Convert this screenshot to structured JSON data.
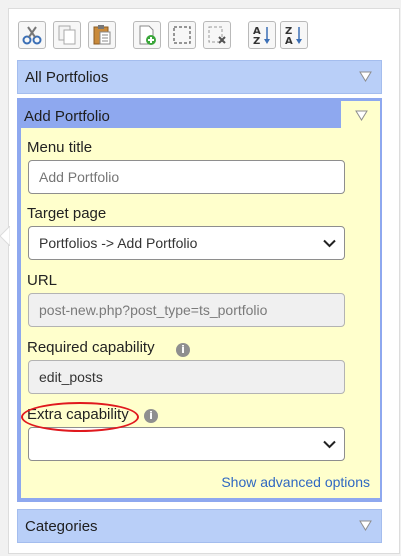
{
  "toolbar": {
    "buttons": [
      {
        "name": "cut",
        "icon": "scissors-icon"
      },
      {
        "name": "copy",
        "icon": "copy-icon"
      },
      {
        "name": "paste",
        "icon": "clipboard-icon"
      },
      {
        "name": "new-menu",
        "icon": "add-page-icon"
      },
      {
        "name": "new-separator",
        "icon": "separator-icon"
      },
      {
        "name": "delete",
        "icon": "delete-page-icon"
      },
      {
        "name": "sort-asc",
        "icon": "sort-az-icon"
      },
      {
        "name": "sort-desc",
        "icon": "sort-za-icon"
      }
    ]
  },
  "sections": {
    "all_portfolios": "All Portfolios",
    "add_portfolio": "Add Portfolio",
    "categories": "Categories"
  },
  "form": {
    "menu_title_label": "Menu title",
    "menu_title_placeholder": "Add Portfolio",
    "target_page_label": "Target page",
    "target_page_value": "Portfolios -> Add Portfolio",
    "url_label": "URL",
    "url_value": "post-new.php?post_type=ts_portfolio",
    "required_cap_label": "Required capability",
    "required_cap_value": "edit_posts",
    "extra_cap_label": "Extra capability",
    "extra_cap_value": "",
    "advanced_link": "Show advanced options",
    "info_glyph": "i"
  },
  "colors": {
    "bar": "#b9cff8",
    "panel_header": "#8ea8ef",
    "panel_body": "#ffffcc",
    "link": "#2f68c2",
    "highlight": "#e0191e"
  }
}
